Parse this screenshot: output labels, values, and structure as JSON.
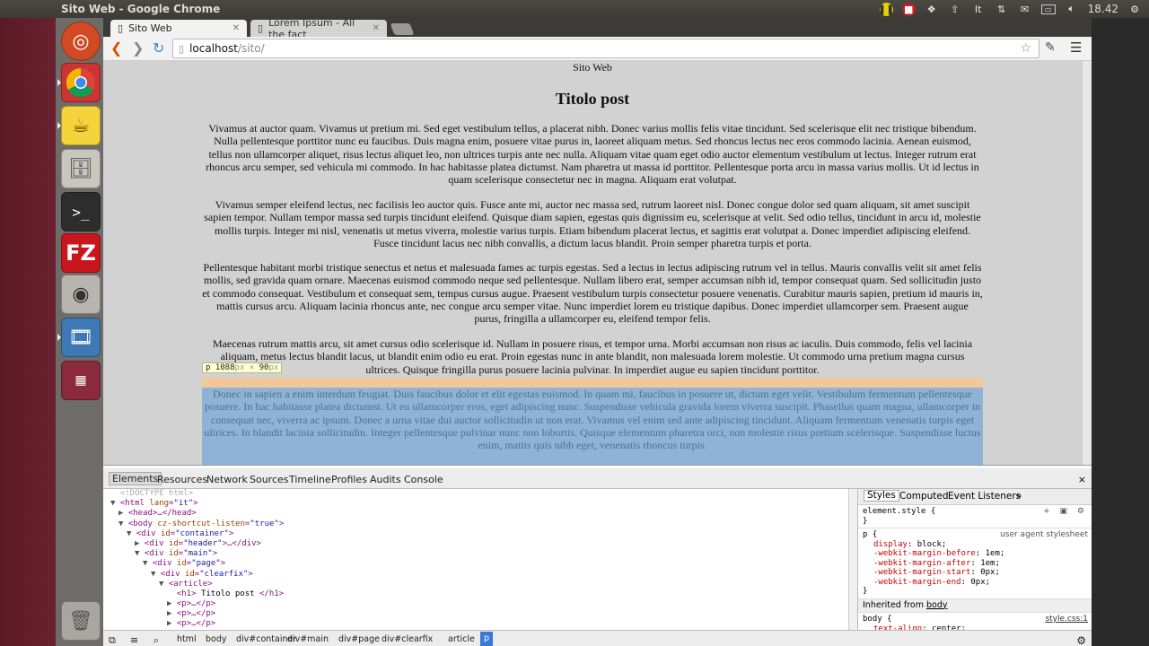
{
  "window": {
    "title": "Sito Web - Google Chrome"
  },
  "tray": {
    "clock": "18.42"
  },
  "tabs": [
    {
      "label": "Sito Web"
    },
    {
      "label": "Lorem Ipsum - All the fact"
    }
  ],
  "address": {
    "host": "localhost",
    "path": "/sito/"
  },
  "page": {
    "site_title": "Sito Web",
    "post_title": "Titolo post",
    "paragraphs": [
      "Vivamus at auctor quam. Vivamus ut pretium mi. Sed eget vestibulum tellus, a placerat nibh. Donec varius mollis felis vitae tincidunt. Sed scelerisque elit nec tristique bibendum. Nulla pellentesque porttitor nunc eu faucibus. Duis magna enim, posuere vitae purus in, laoreet aliquam metus. Sed rhoncus lectus nec eros commodo lacinia. Aenean euismod, tellus non ullamcorper aliquet, risus lectus aliquet leo, non ultrices turpis ante nec nulla. Aliquam vitae quam eget odio auctor elementum vestibulum ut lectus. Integer rutrum erat rhoncus arcu semper, sed vehicula mi commodo. In hac habitasse platea dictumst. Nam pharetra ut massa id porttitor. Pellentesque porta arcu in massa varius mollis. Ut id lectus in quam scelerisque consectetur nec in magna. Aliquam erat volutpat.",
      "Vivamus semper eleifend lectus, nec facilisis leo auctor quis. Fusce ante mi, auctor nec massa sed, rutrum laoreet nisl. Donec congue dolor sed quam aliquam, sit amet suscipit sapien tempor. Nullam tempor massa sed turpis tincidunt eleifend. Quisque diam sapien, egestas quis dignissim eu, scelerisque at velit. Sed odio tellus, tincidunt in arcu id, molestie mollis turpis. Integer mi nisl, venenatis ut metus viverra, molestie varius turpis. Etiam bibendum placerat lectus, et sagittis erat volutpat a. Donec imperdiet adipiscing eleifend. Fusce tincidunt lacus nec nibh convallis, a dictum lacus blandit. Proin semper pharetra turpis et porta.",
      "Pellentesque habitant morbi tristique senectus et netus et malesuada fames ac turpis egestas. Sed a lectus in lectus adipiscing rutrum vel in tellus. Mauris convallis velit sit amet felis mollis, sed gravida quam ornare. Maecenas euismod commodo neque sed pellentesque. Nullam libero erat, semper accumsan nibh id, tempor consequat quam. Sed sollicitudin justo et commodo consequat. Vestibulum et consequat sem, tempus cursus augue. Praesent vestibulum turpis consectetur posuere venenatis. Curabitur mauris sapien, pretium id mauris in, mattis cursus arcu. Aliquam lacinia rhoncus ante, nec congue arcu semper vitae. Nunc imperdiet lorem eu tristique dapibus. Donec imperdiet ullamcorper sem. Praesent augue purus, fringilla a ullamcorper eu, eleifend tempor felis.",
      "Maecenas rutrum mattis arcu, sit amet cursus odio scelerisque id. Nullam in posuere risus, et tempor urna. Morbi accumsan non risus ac iaculis. Duis commodo, felis vel lacinia aliquam, metus lectus blandit lacus, ut blandit enim odio eu erat. Proin egestas nunc in ante blandit, non malesuada lorem molestie. Ut commodo urna pretium magna cursus ultrices. Quisque fringilla purus posuere lacinia pulvinar. In imperdiet augue eu sapien tincidunt porttitor.",
      "Donec in sapien a enim interdum feugiat. Duis faucibus dolor et elit egestas euismod. In quam mi, faucibus in posuere ut, dictum eget velit. Vestibulum fermentum pellentesque posuere. In hac habitasse platea dictumst. Ut eu ullamcorper eros, eget adipiscing nunc. Suspendisse vehicula gravida lorem viverra suscipit. Phasellus quam magna, ullamcorper in consequat nec, viverra ac ipsum. Donec a urna vitae dui auctor sollicitudin ut non erat. Vivamus vel enim sed ante adipiscing tincidunt. Aliquam fermentum venenatis turpis eget ultrices. In blandit lacinia sollicitudin. Integer pellentesque pulvinar nunc non lobortis. Quisque elementum pharetra orci, non molestie risus pretium scelerisque. Suspendisse luctus enim, mattis quis nibh eget, venenatis rhoncus turpis."
    ],
    "tooltip": {
      "tag": "p",
      "width": "1088",
      "height": "90",
      "unit": "px",
      "times": "×"
    }
  },
  "devtools": {
    "tabs": [
      "Elements",
      "Resources",
      "Network",
      "Sources",
      "Timeline",
      "Profiles",
      "Audits",
      "Console"
    ],
    "close": "×",
    "dom": [
      {
        "indent": 0,
        "tri": "",
        "html": "<!DOCTYPE html>",
        "dim": true
      },
      {
        "indent": 0,
        "tri": "▼",
        "tag": "html",
        "attrs": [
          [
            "lang",
            "\"it\""
          ]
        ],
        "close": ""
      },
      {
        "indent": 1,
        "tri": "▶",
        "tag": "head",
        "collapsed": "…</head>"
      },
      {
        "indent": 1,
        "tri": "▼",
        "tag": "body",
        "attrs": [
          [
            "cz-shortcut-listen",
            "\"true\""
          ]
        ]
      },
      {
        "indent": 2,
        "tri": "▼",
        "tag": "div",
        "attrs": [
          [
            "id",
            "\"container\""
          ]
        ]
      },
      {
        "indent": 3,
        "tri": "▶",
        "tag": "div",
        "attrs": [
          [
            "id",
            "\"header\""
          ]
        ],
        "collapsed": "…</div>"
      },
      {
        "indent": 3,
        "tri": "▼",
        "tag": "div",
        "attrs": [
          [
            "id",
            "\"main\""
          ]
        ]
      },
      {
        "indent": 4,
        "tri": "▼",
        "tag": "div",
        "attrs": [
          [
            "id",
            "\"page\""
          ]
        ]
      },
      {
        "indent": 5,
        "tri": "▼",
        "tag": "div",
        "attrs": [
          [
            "id",
            "\"clearfix\""
          ]
        ]
      },
      {
        "indent": 6,
        "tri": "▼",
        "tag": "article"
      },
      {
        "indent": 7,
        "tri": "",
        "tag": "h1",
        "text": " Titolo post ",
        "endtag": "</h1>"
      },
      {
        "indent": 7,
        "tri": "▶",
        "tag": "p",
        "collapsed": "…</p>"
      },
      {
        "indent": 7,
        "tri": "▶",
        "tag": "p",
        "collapsed": "…</p>"
      },
      {
        "indent": 7,
        "tri": "▶",
        "tag": "p",
        "collapsed": "…</p>"
      },
      {
        "indent": 7,
        "tri": "▶",
        "tag": "p",
        "collapsed": "…</p>"
      },
      {
        "indent": 7,
        "tri": "▶",
        "tag": "p",
        "collapsed": "…</p>",
        "selected": true
      }
    ],
    "styles": {
      "tabs": [
        "Styles",
        "Computed",
        "Event Listeners",
        "»"
      ],
      "element_style": "element.style {",
      "rule_close": "}",
      "p_rule": {
        "selector": "p {",
        "source": "user agent stylesheet",
        "props": [
          [
            "display",
            "block;"
          ],
          [
            "-webkit-margin-before",
            "1em;"
          ],
          [
            "-webkit-margin-after",
            "1em;"
          ],
          [
            "-webkit-margin-start",
            "0px;"
          ],
          [
            "-webkit-margin-end",
            "0px;"
          ]
        ]
      },
      "inherited_label": "Inherited from",
      "inherited_from": "body",
      "body_rule": {
        "selector": "body {",
        "source": "style.css:1",
        "props": [
          [
            "text-align",
            "center;"
          ]
        ]
      }
    },
    "breadcrumbs": [
      "html",
      "body",
      "div#container",
      "div#main",
      "div#page",
      "div#clearfix",
      "article",
      "p"
    ]
  }
}
